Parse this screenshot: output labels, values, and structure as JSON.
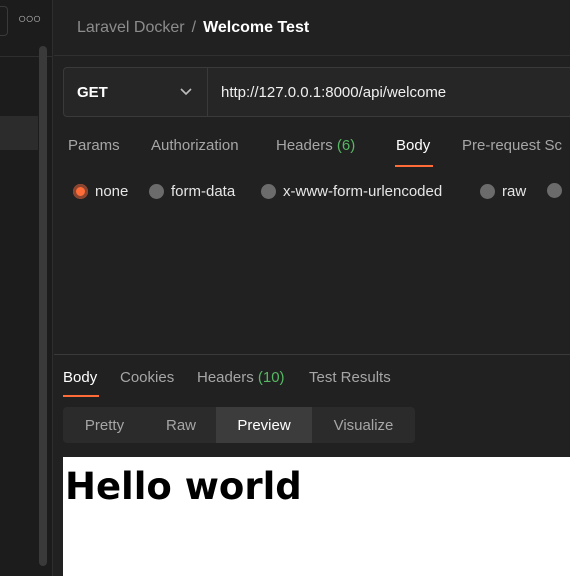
{
  "breadcrumb": {
    "parent": "Laravel Docker",
    "separator": "/",
    "current": "Welcome Test"
  },
  "request": {
    "method": "GET",
    "url": "http://127.0.0.1:8000/api/welcome"
  },
  "request_tabs": {
    "params": "Params",
    "authorization": "Authorization",
    "headers": "Headers",
    "headers_count": "(6)",
    "body": "Body",
    "prerequest": "Pre-request Sc"
  },
  "body_types": {
    "none": "none",
    "form_data": "form-data",
    "urlencoded": "x-www-form-urlencoded",
    "raw": "raw",
    "selected": "none"
  },
  "response_tabs": {
    "body": "Body",
    "cookies": "Cookies",
    "headers": "Headers",
    "headers_count": "(10)",
    "test_results": "Test Results"
  },
  "view_modes": {
    "pretty": "Pretty",
    "raw": "Raw",
    "preview": "Preview",
    "visualize": "Visualize",
    "active": "Preview"
  },
  "preview": {
    "heading": "Hello world"
  },
  "colors": {
    "accent": "#ff6c37",
    "count_green": "#56b863"
  }
}
